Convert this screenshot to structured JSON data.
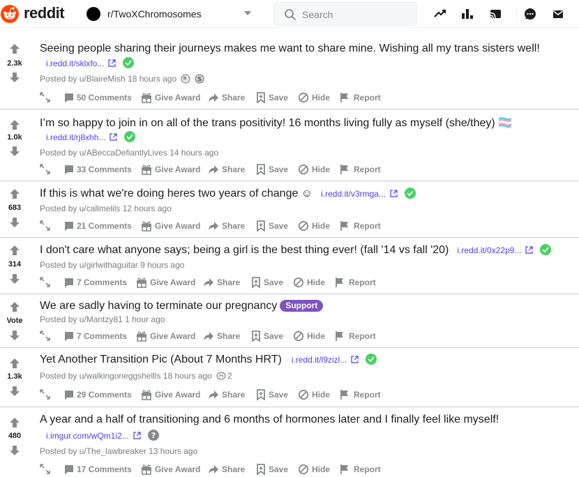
{
  "header": {
    "logo_text": "reddit",
    "subreddit": "r/TwoXChromosomes",
    "search_placeholder": "Search"
  },
  "actions": {
    "give_award": "Give Award",
    "share": "Share",
    "save": "Save",
    "hide": "Hide",
    "report": "Report"
  },
  "posts": [
    {
      "score": "2.3k",
      "title": "Seeing people sharing their journeys makes me want to share mine. Wishing all my trans sisters well!",
      "link": "i.redd.it/sklxfo...",
      "meta": "Posted by u/BlaireMish 18 hours ago",
      "comments": "50 Comments"
    },
    {
      "score": "1.0k",
      "title": "I’m so happy to join in on all of the trans positivity! 16 months living fully as myself (she/they) 🏳️‍⚧️",
      "link": "i.redd.it/rj8xhh...",
      "meta": "Posted by u/ABeccaDefiantlyLives 14 hours ago",
      "comments": "33 Comments"
    },
    {
      "score": "683",
      "title": "If this is what we're doing heres two years of change ☺",
      "link": "i.redd.it/v3rmga...",
      "meta": "Posted by u/callmelils 12 hours ago",
      "comments": "21 Comments"
    },
    {
      "score": "314",
      "title": "I don't care what anyone says; being a girl is the best thing ever! (fall '14 vs fall '20)",
      "link": "i.redd.it/0x22p9...",
      "meta": "Posted by u/girlwithaguitar 9 hours ago",
      "comments": "7 Comments"
    },
    {
      "score": "Vote",
      "title": "We are sadly having to terminate our pregnancy",
      "flair": "Support",
      "meta": "Posted by u/Mantzy81 1 hour ago",
      "comments": "7 Comments"
    },
    {
      "score": "1.3k",
      "title": "Yet Another Transition Pic (About 7 Months HRT)",
      "link": "i.redd.it/l9zizl...",
      "meta": "Posted by u/walkingoneggshellls 18 hours ago",
      "award_count": "2",
      "comments": "29 Comments"
    },
    {
      "score": "480",
      "title": "A year and a half of transitioning and 6 months of hormones later and I finally feel like myself!",
      "link": "i.imgur.com/wQm1i2...",
      "meta": "Posted by u/The_lawbreaker 13 hours ago",
      "comments": "17 Comments"
    }
  ],
  "colors": {
    "brand": "#ff4500",
    "upvote_gray": "#878a8c",
    "check_green": "#46d160",
    "flair_purple": "#7e53c1",
    "link_purple": "#4c3ee8"
  }
}
